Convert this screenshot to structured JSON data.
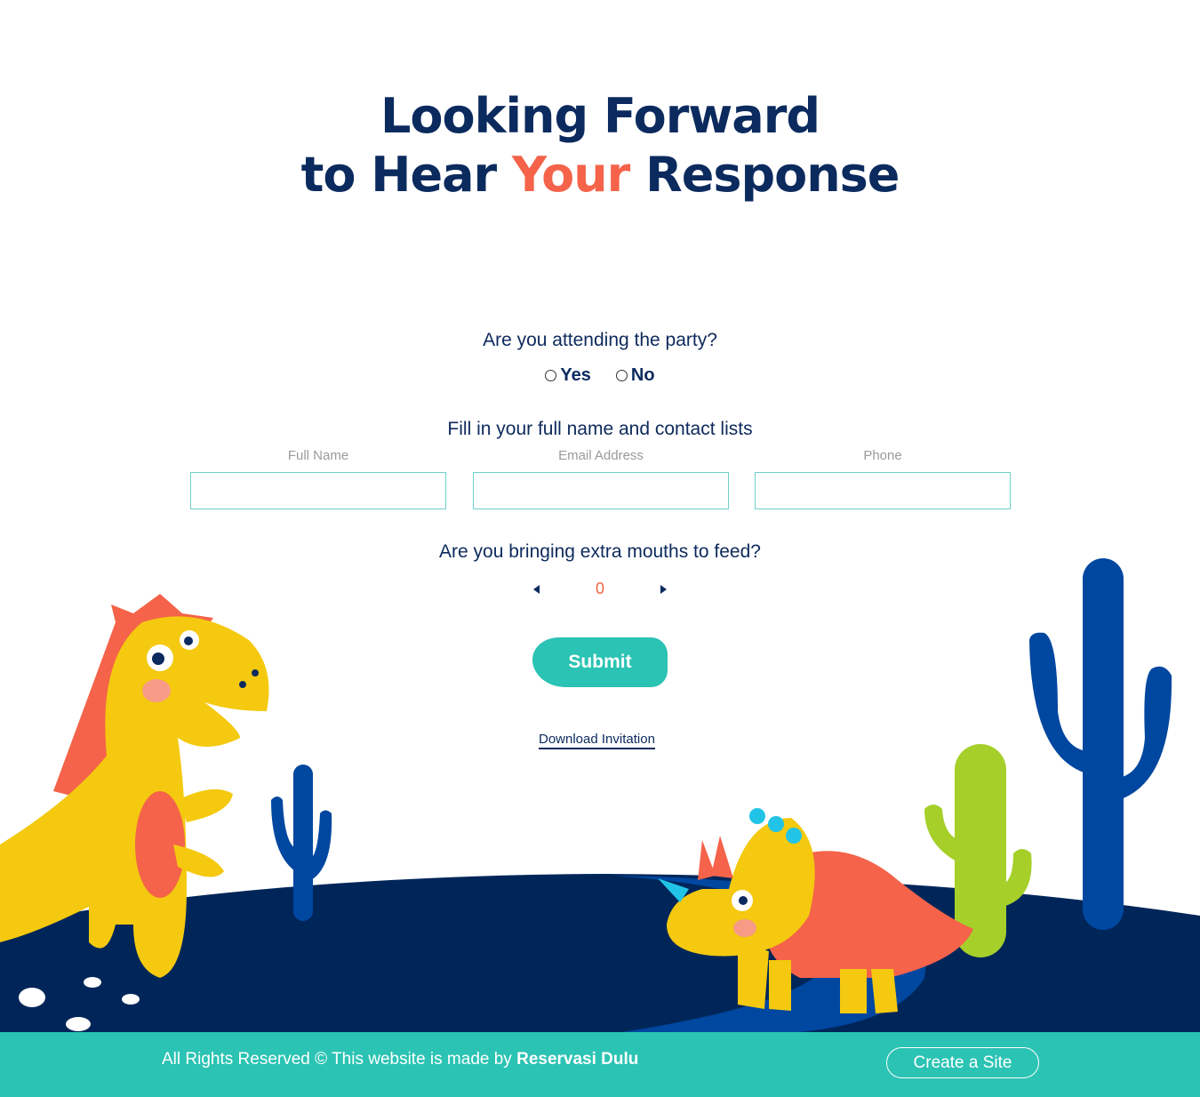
{
  "heading": {
    "line1": "Looking Forward",
    "line2_pre": "to Hear ",
    "line2_accent": "Your",
    "line2_post": " Response"
  },
  "attendance": {
    "question": "Are you attending the party?",
    "options": [
      "Yes",
      "No"
    ]
  },
  "contact": {
    "prompt": "Fill in your full name and contact lists",
    "fields": [
      {
        "label": "Full Name",
        "value": ""
      },
      {
        "label": "Email Address",
        "value": ""
      },
      {
        "label": "Phone",
        "value": ""
      }
    ]
  },
  "guests": {
    "question": "Are you bringing extra mouths to feed?",
    "count": "0"
  },
  "submit_label": "Submit",
  "download_label": "Download Invitation",
  "footer": {
    "copy": "All Rights Reserved © This website is made by ",
    "brand": "Reservasi Dulu",
    "cta": "Create a Site"
  },
  "colors": {
    "navy": "#0b2a5e",
    "accent": "#f4634a",
    "teal": "#2bc3b3",
    "ground": "#002659"
  }
}
